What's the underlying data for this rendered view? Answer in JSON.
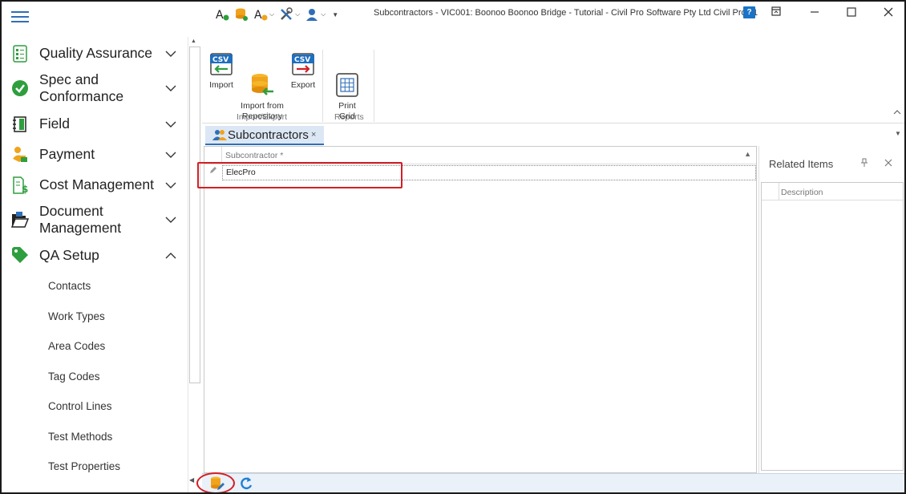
{
  "window": {
    "title": "Subcontractors - VIC001: Boonoo Boonoo Bridge - Tutorial - Civil Pro Software Pty Ltd Civil Pro 11",
    "help_label": "?"
  },
  "sidebar": {
    "items": [
      {
        "label": "Quality Assurance"
      },
      {
        "label": "Spec and\nConformance"
      },
      {
        "label": "Field"
      },
      {
        "label": "Payment"
      },
      {
        "label": "Cost Management"
      },
      {
        "label": "Document\nManagement"
      },
      {
        "label": "QA Setup"
      }
    ],
    "sub_items": [
      {
        "label": "Contacts"
      },
      {
        "label": "Work Types"
      },
      {
        "label": "Area Codes"
      },
      {
        "label": "Tag Codes"
      },
      {
        "label": "Control Lines"
      },
      {
        "label": "Test Methods"
      },
      {
        "label": "Test Properties"
      }
    ]
  },
  "ribbon": {
    "groups": [
      {
        "label": "Import/Export"
      },
      {
        "label": "Reports"
      }
    ],
    "buttons": [
      {
        "label": "Import"
      },
      {
        "label": "Import from\nRepository"
      },
      {
        "label": "Export"
      },
      {
        "label": "Print\nGrid"
      }
    ],
    "csv_badge": "CSV"
  },
  "document_tab": {
    "label": "Subcontractors",
    "close": "×"
  },
  "grid": {
    "column_header": "Subcontractor *",
    "rows": [
      {
        "subcontractor": "ElecPro"
      }
    ]
  },
  "related_items": {
    "title": "Related Items",
    "column_header": "Description"
  },
  "colors": {
    "accent": "#2f6fb7",
    "highlight": "#d31f26",
    "status_bar": "#eaf1f9"
  }
}
